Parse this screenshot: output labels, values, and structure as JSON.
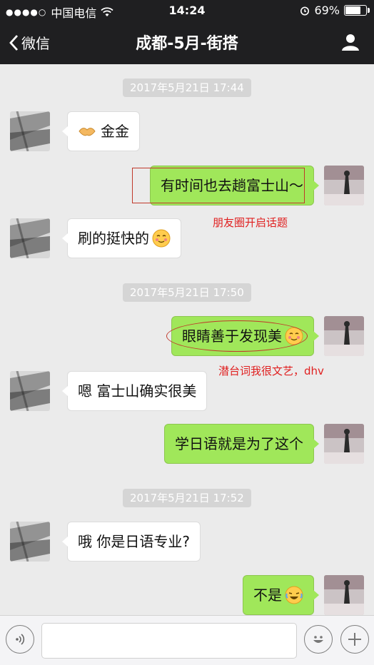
{
  "status_bar": {
    "carrier": "中国电信",
    "time": "14:24",
    "battery": "69%",
    "battery_level": 0.69
  },
  "nav": {
    "back_label": "微信",
    "title": "成都-5月-街搭"
  },
  "messages": [
    {
      "ts": "2017年5月21日 17:44"
    },
    {
      "from": "other",
      "text": "金金",
      "emoji": "handshake"
    },
    {
      "from": "me",
      "text": "有时间也去趟富士山～"
    },
    {
      "from": "other",
      "text": "刷的挺快的",
      "emoji": "blush"
    },
    {
      "ts": "2017年5月21日 17:50"
    },
    {
      "from": "me",
      "text": "眼睛善于发现美",
      "emoji": "blush"
    },
    {
      "from": "other",
      "text": "嗯 富士山确实很美"
    },
    {
      "from": "me",
      "text": "学日语就是为了这个"
    },
    {
      "ts": "2017年5月21日 17:52"
    },
    {
      "from": "other",
      "text": "哦 你是日语专业?"
    },
    {
      "from": "me",
      "text": "不是",
      "emoji": "joy"
    }
  ],
  "annotations": [
    "朋友圈开启话题",
    "潜台词我很文艺，dhv"
  ],
  "input_bar": {
    "placeholder": ""
  }
}
